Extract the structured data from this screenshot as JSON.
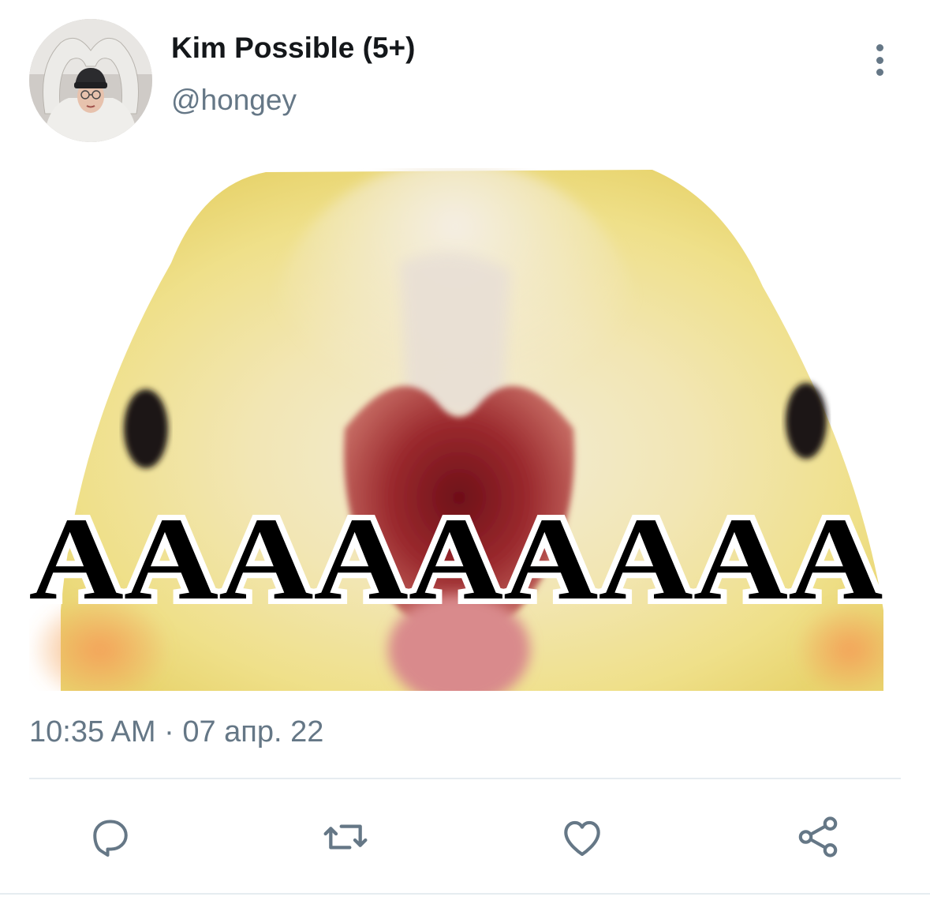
{
  "tweet": {
    "author": {
      "display_name": "Kim Possible (5+)",
      "handle": "@hongey",
      "avatar_icon": "user-avatar"
    },
    "more_icon": "more-vertical-icon",
    "media": {
      "overlay_text": "AAAAAAAAA",
      "description_icon": "screaming-bird-meme-image"
    },
    "timestamp": "10:35 AM · 07 апр. 22",
    "actions": [
      {
        "name": "reply",
        "icon": "reply-icon"
      },
      {
        "name": "retweet",
        "icon": "retweet-icon"
      },
      {
        "name": "like",
        "icon": "heart-icon"
      },
      {
        "name": "share",
        "icon": "share-icon"
      }
    ],
    "colors": {
      "primary_text": "#14171a",
      "secondary_text": "#657786",
      "icon": "#657786",
      "divider": "#e6ecf0"
    }
  }
}
